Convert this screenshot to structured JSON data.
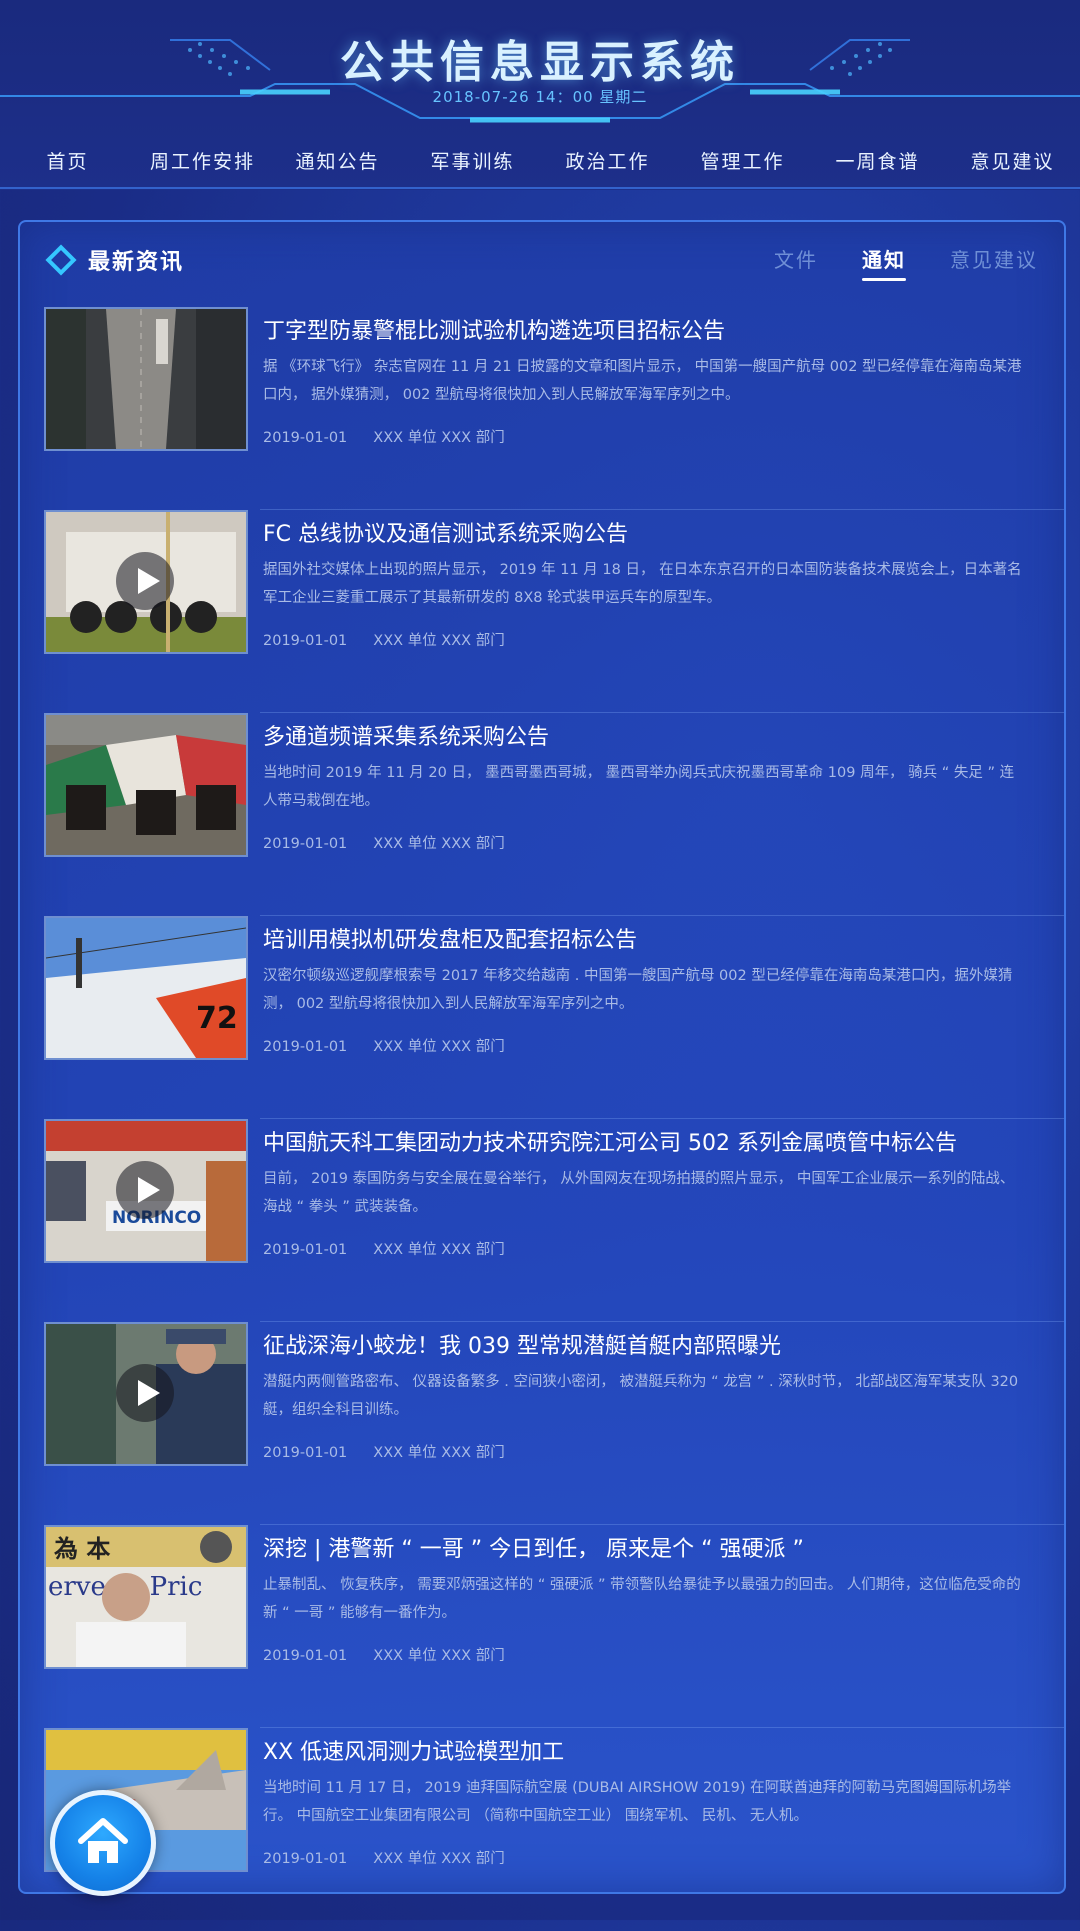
{
  "header": {
    "title": "公共信息显示系统",
    "datetime": "2018-07-26  14：00  星期二"
  },
  "nav": [
    {
      "label": "首页"
    },
    {
      "label": "周工作安排"
    },
    {
      "label": "通知公告"
    },
    {
      "label": "军事训练"
    },
    {
      "label": "政治工作"
    },
    {
      "label": "管理工作"
    },
    {
      "label": "一周食谱"
    },
    {
      "label": "意见建议"
    }
  ],
  "panel": {
    "title": "最新资讯",
    "icon": "diamond-icon",
    "tabs": [
      {
        "label": "文件",
        "active": false
      },
      {
        "label": "通知",
        "active": true
      },
      {
        "label": "意见建议",
        "active": false
      }
    ]
  },
  "items": [
    {
      "title": "丁字型防暴警棍比测试验机构遴选项目招标公告",
      "desc": "据 《环球飞行》 杂志官网在 11 月 21 日披露的文章和图片显示， 中国第一艘国产航母 002 型已经停靠在海南岛某港口内， 据外媒猜测， 002 型航母将很快加入到人民解放军海军序列之中。",
      "date": "2019-01-01",
      "dept": "XXX 单位 XXX 部门",
      "video": false
    },
    {
      "title": "FC 总线协议及通信测试系统采购公告",
      "desc": "据国外社交媒体上出现的照片显示， 2019 年 11 月 18 日， 在日本东京召开的日本国防装备技术展览会上，日本著名军工企业三菱重工展示了其最新研发的 8X8 轮式装甲运兵车的原型车。",
      "date": "2019-01-01",
      "dept": "XXX 单位 XXX 部门",
      "video": true
    },
    {
      "title": "多通道频谱采集系统采购公告",
      "desc": "当地时间 2019 年 11 月 20 日， 墨西哥墨西哥城， 墨西哥举办阅兵式庆祝墨西哥革命 109 周年， 骑兵 “ 失足 ” 连人带马栽倒在地。",
      "date": "2019-01-01",
      "dept": "XXX 单位 XXX 部门",
      "video": false
    },
    {
      "title": "培训用模拟机研发盘柜及配套招标公告",
      "desc": "汉密尔顿级巡逻舰摩根索号 2017 年移交给越南 . 中国第一艘国产航母 002 型已经停靠在海南岛某港口内，据外媒猜测， 002 型航母将很快加入到人民解放军海军序列之中。",
      "date": "2019-01-01",
      "dept": "XXX 单位 XXX 部门",
      "video": false
    },
    {
      "title": "中国航天科工集团动力技术研究院江河公司 502 系列金属喷管中标公告",
      "desc": "目前， 2019 泰国防务与安全展在曼谷举行， 从外国网友在现场拍摄的照片显示， 中国军工企业展示一系列的陆战、 海战 “ 拳头 ” 武装装备。",
      "date": "2019-01-01",
      "dept": "XXX 单位 XXX 部门",
      "video": true
    },
    {
      "title": "征战深海小蛟龙！我 039 型常规潜艇首艇内部照曝光",
      "desc": "潜艇内两侧管路密布、 仪器设备繁多 . 空间狭小密闭， 被潜艇兵称为 “ 龙宫 ” . 深秋时节， 北部战区海军某支队 320 艇，组织全科目训练。",
      "date": "2019-01-01",
      "dept": "XXX 单位 XXX 部门",
      "video": true
    },
    {
      "title": "深挖 | 港警新 “ 一哥 ” 今日到任， 原来是个 “ 强硬派 ”",
      "desc": "止暴制乱、 恢复秩序， 需要邓炳强这样的 “ 强硬派 ” 带领警队给暴徒予以最强力的回击。 人们期待，这位临危受命的新 “ 一哥 ” 能够有一番作为。",
      "date": "2019-01-01",
      "dept": "XXX 单位 XXX 部门",
      "video": false
    },
    {
      "title": "XX 低速风洞测力试验模型加工",
      "desc": "当地时间 11 月 17 日， 2019 迪拜国际航空展 (DUBAI AIRSHOW 2019) 在阿联酋迪拜的阿勒马克图姆国际机场举行。 中国航空工业集团有限公司 （简称中国航空工业） 围绕军机、 民机、 无人机。",
      "date": "2019-01-01",
      "dept": "XXX 单位 XXX 部门",
      "video": false
    }
  ],
  "thumb_texts": {
    "ship_number": "72",
    "booth_sign": "NORINCO",
    "banner_text": "為 本",
    "banner_sub": "erve th Pric"
  },
  "home_button": {
    "icon": "home-icon"
  }
}
